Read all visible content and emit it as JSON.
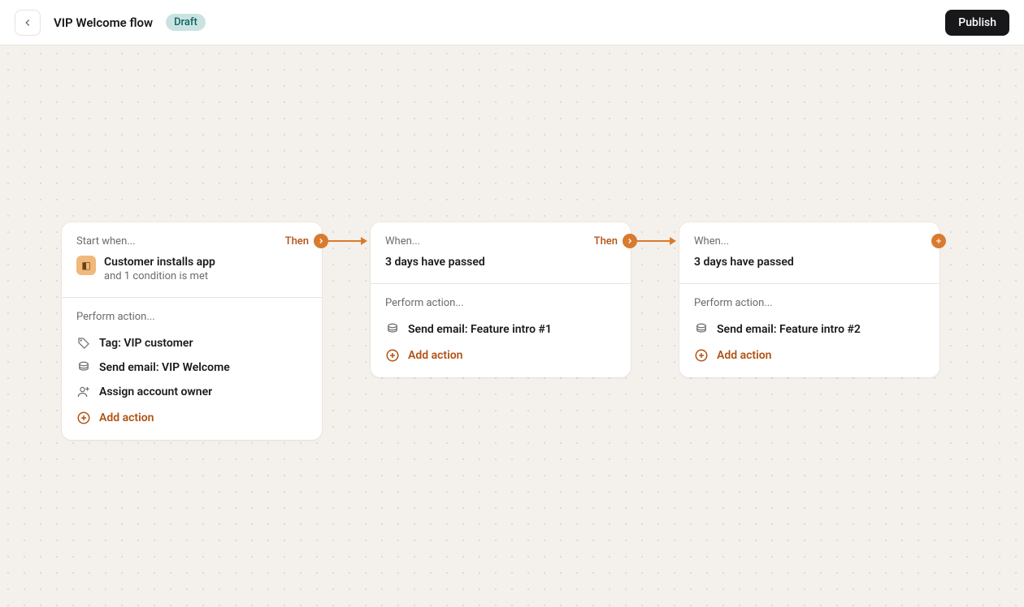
{
  "header": {
    "title": "VIP Welcome flow",
    "status_badge": "Draft",
    "publish_label": "Publish"
  },
  "labels": {
    "then": "Then",
    "add_action": "Add action",
    "perform_action": "Perform action...",
    "start_when": "Start when...",
    "when": "When..."
  },
  "steps": [
    {
      "trigger_label_key": "start_when",
      "trigger_type": "event",
      "trigger_main": "Customer installs app",
      "trigger_sub": "and 1 condition is met",
      "actions": [
        {
          "icon": "tag",
          "text": "Tag: VIP customer"
        },
        {
          "icon": "email",
          "text": "Send email: VIP Welcome"
        },
        {
          "icon": "owner",
          "text": "Assign account owner"
        }
      ]
    },
    {
      "trigger_label_key": "when",
      "trigger_type": "wait",
      "wait_text": "3 days have passed",
      "actions": [
        {
          "icon": "email",
          "text": "Send email: Feature intro #1"
        }
      ]
    },
    {
      "trigger_label_key": "when",
      "trigger_type": "wait",
      "wait_text": "3 days have passed",
      "actions": [
        {
          "icon": "email",
          "text": "Send email: Feature intro #2"
        }
      ]
    }
  ]
}
